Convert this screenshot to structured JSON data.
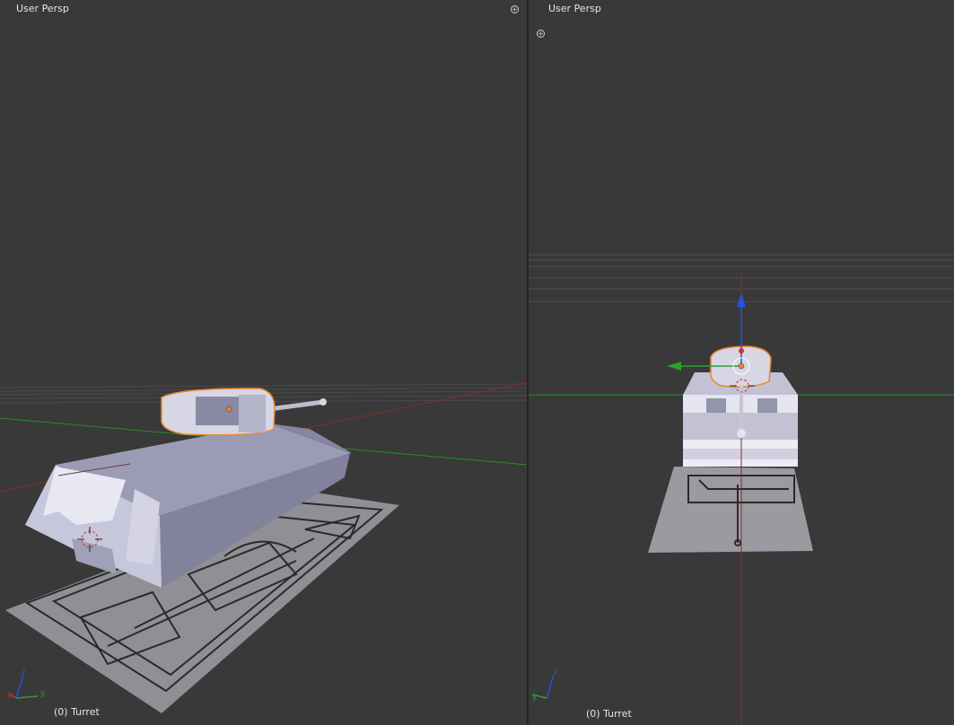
{
  "left_viewport": {
    "title": "User Persp",
    "active_object": "(0) Turret",
    "axes": {
      "x": "x",
      "y": "y",
      "z": "z"
    }
  },
  "right_viewport": {
    "title": "User Persp",
    "active_object": "(0) Turret",
    "axes": {
      "y": "y",
      "z": "z"
    }
  },
  "colors": {
    "background": "#393939",
    "selection_outline": "#e8892a",
    "x_axis": "#c83232",
    "y_axis": "#2ea02e",
    "z_axis": "#2850e0"
  },
  "icons": [
    "viewport-split-icon",
    "viewport-split-icon",
    "3d-cursor-icon",
    "axis-gizmo-icon",
    "transform-manipulator-icon"
  ]
}
